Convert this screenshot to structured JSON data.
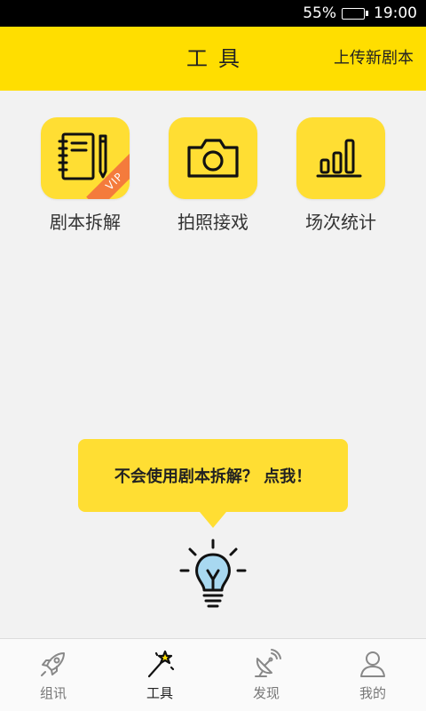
{
  "status": {
    "battery_percent": "55%",
    "battery_level": 0.55,
    "time": "19:00"
  },
  "header": {
    "title": "工具",
    "upload_label": "上传新剧本"
  },
  "tools": [
    {
      "label": "剧本拆解",
      "icon": "notebook-pencil-icon",
      "badge": "VIP"
    },
    {
      "label": "拍照接戏",
      "icon": "camera-icon"
    },
    {
      "label": "场次统计",
      "icon": "bar-chart-icon"
    }
  ],
  "tip": {
    "text": "不会使用剧本拆解？ 点我！",
    "icon": "lightbulb-icon"
  },
  "tabs": [
    {
      "label": "组讯",
      "icon": "rocket-icon",
      "active": false
    },
    {
      "label": "工具",
      "icon": "magic-wand-icon",
      "active": true
    },
    {
      "label": "发现",
      "icon": "satellite-dish-icon",
      "active": false
    },
    {
      "label": "我的",
      "icon": "user-icon",
      "active": false
    }
  ],
  "colors": {
    "accent": "#ffde00",
    "tile": "#ffde33",
    "vip": "#f47b3c",
    "bulb": "#a8d8f0"
  }
}
